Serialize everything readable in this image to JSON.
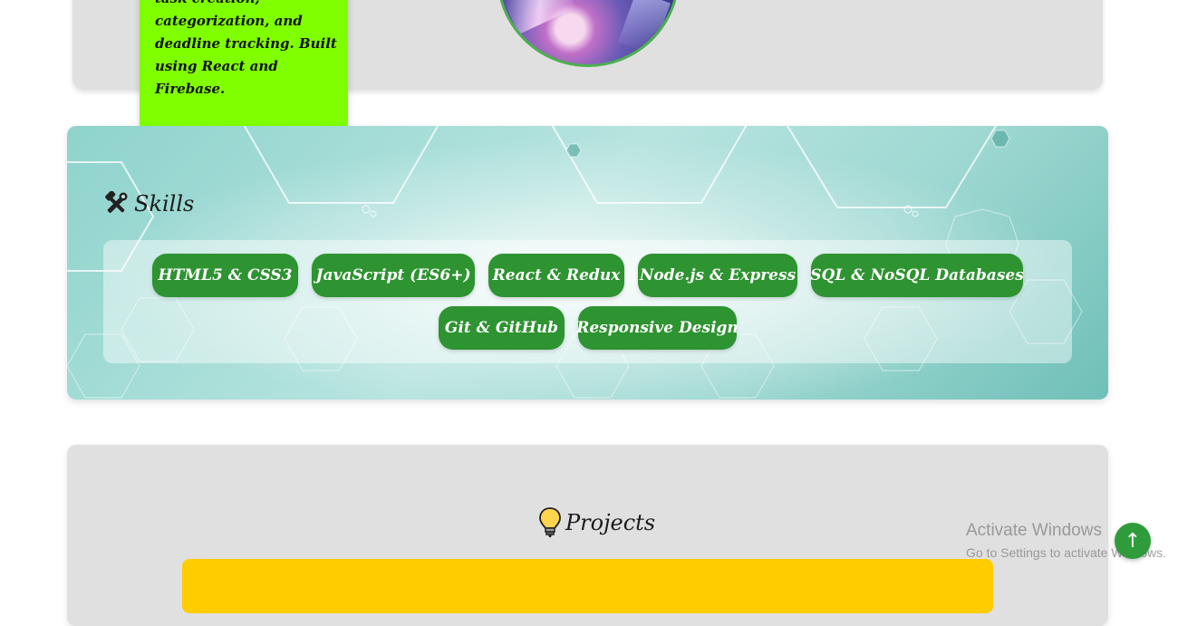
{
  "about": {
    "note_text": "task creation, categorization, and deadline tracking. Built using React and Firebase."
  },
  "skills": {
    "title": "Skills",
    "icon": "tools-icon",
    "items": [
      {
        "label": "HTML5 & CSS3"
      },
      {
        "label": "JavaScript (ES6+)"
      },
      {
        "label": "React & Redux"
      },
      {
        "label": "Node.js & Express"
      },
      {
        "label": "SQL & NoSQL Databases"
      },
      {
        "label": "Git & GitHub"
      },
      {
        "label": "Responsive Design"
      }
    ]
  },
  "projects": {
    "title": "Projects",
    "icon": "lightbulb-icon"
  },
  "watermark": {
    "line1": "Activate Windows",
    "line2": "Go to Settings to activate Windows."
  },
  "scroll_top": {
    "icon": "arrow-up-icon",
    "glyph": "↑"
  },
  "colors": {
    "chip_green": "#2e9331",
    "note_green": "#80ff00",
    "project_yellow": "#ffcc00"
  }
}
